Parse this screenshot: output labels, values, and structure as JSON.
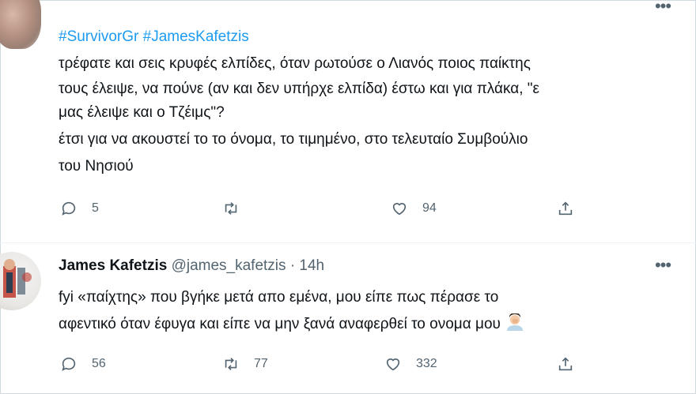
{
  "tweet1": {
    "hashtags": [
      "#SurvivorGr",
      "#JamesKafetzis"
    ],
    "lines": [
      "τρέφατε και σεις κρυφές ελπίδες, όταν ρωτούσε ο Λιανός ποιος παίκτης",
      "τους έλειψε, να πούνε (αν και δεν υπήρχε ελπίδα) έστω και για πλάκα, \"ε",
      "μας έλειψε και ο Τζέιμς\"?",
      "έτσι για να ακουστεί το το όνομα, το τιμημένο, στο τελευταίο Συμβούλιο",
      "του Νησιού"
    ],
    "replies": "5",
    "likes": "94"
  },
  "tweet2": {
    "author_name": "James Kafetzis",
    "author_handle": "@james_kafetzis",
    "separator": "·",
    "time": "14h",
    "lines": [
      "fyi «παίχτης» που βγήκε μετά απο εμένα, μου είπε πως πέρασε το",
      "αφεντικό όταν έφυγα και είπε να μην ξανά αναφερθεί το ονομα μου"
    ],
    "emoji": "man-facepalming",
    "replies": "56",
    "retweets": "77",
    "likes": "332"
  },
  "colors": {
    "hashtag": "#1d9bf0",
    "secondary_text": "#536471",
    "primary_text": "#0f1419"
  },
  "icons": [
    "reply-icon",
    "retweet-icon",
    "like-icon",
    "share-icon",
    "more-icon",
    "facepalm-emoji-icon"
  ]
}
